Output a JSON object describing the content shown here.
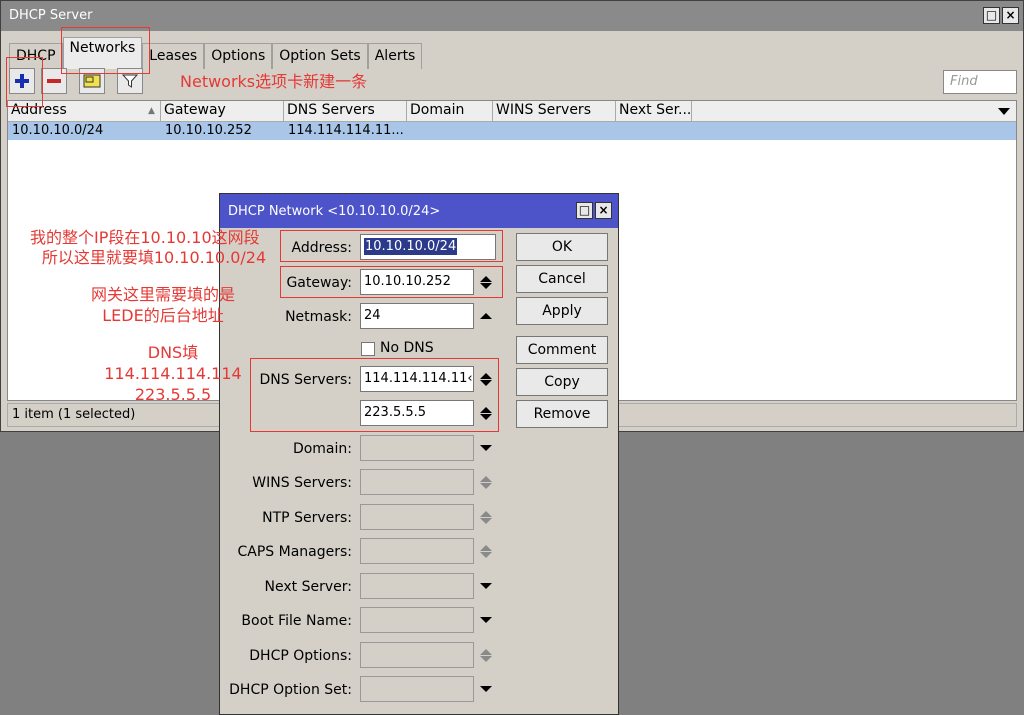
{
  "window": {
    "title": "DHCP Server",
    "maximize": "□",
    "close": "×"
  },
  "tabs": [
    "DHCP",
    "Networks",
    "Leases",
    "Options",
    "Option Sets",
    "Alerts"
  ],
  "toolbar": {
    "find_placeholder": "Find"
  },
  "table": {
    "columns": [
      "Address",
      "Gateway",
      "DNS Servers",
      "Domain",
      "WINS Servers",
      "Next Ser..."
    ],
    "rows": [
      {
        "address": "10.10.10.0/24",
        "gateway": "10.10.10.252",
        "dns": "114.114.114.11..."
      }
    ]
  },
  "status": "1 item (1 selected)",
  "dialog": {
    "title": "DHCP Network <10.10.10.0/24>",
    "maximize": "□",
    "close": "×",
    "labels": {
      "address": "Address:",
      "gateway": "Gateway:",
      "netmask": "Netmask:",
      "no_dns": "No DNS",
      "dns_servers": "DNS Servers:",
      "domain": "Domain:",
      "wins": "WINS Servers:",
      "ntp": "NTP Servers:",
      "caps": "CAPS Managers:",
      "next_server": "Next Server:",
      "boot_file": "Boot File Name:",
      "dhcp_options": "DHCP Options:",
      "dhcp_option_set": "DHCP Option Set:"
    },
    "values": {
      "address": "10.10.10.0/24",
      "gateway": "10.10.10.252",
      "netmask": "24",
      "dns1": "114.114.114.11‹",
      "dns2": "223.5.5.5"
    },
    "buttons": {
      "ok": "OK",
      "cancel": "Cancel",
      "apply": "Apply",
      "comment": "Comment",
      "copy": "Copy",
      "remove": "Remove"
    }
  },
  "annotations": {
    "networks_tab": "Networks选项卡新建一条",
    "ip_line1": "我的整个IP段在10.10.10这网段",
    "ip_line2": "所以这里就要填10.10.10.0/24",
    "gw_line1": "网关这里需要填的是",
    "gw_line2": "LEDE的后台地址",
    "dns_line1": "DNS填",
    "dns_line2": "114.114.114.114",
    "dns_line3": "223.5.5.5"
  },
  "colors": {
    "annotation": "#e53935",
    "dialog_title": "#4d53c8",
    "selected_row": "#a9c6e8"
  }
}
